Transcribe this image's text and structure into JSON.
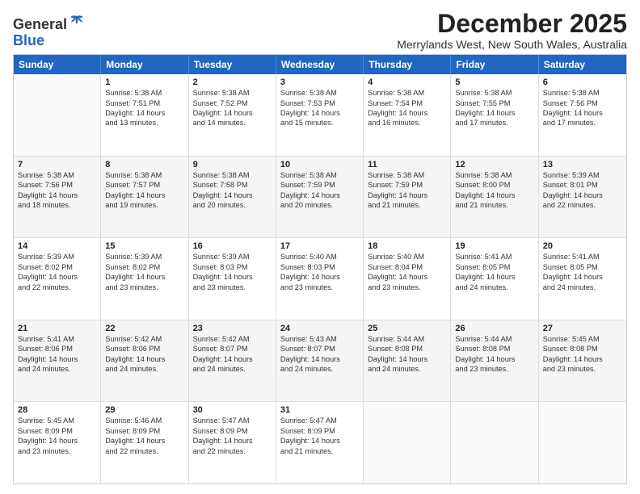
{
  "logo": {
    "general": "General",
    "blue": "Blue"
  },
  "title": "December 2025",
  "location": "Merrylands West, New South Wales, Australia",
  "days": [
    "Sunday",
    "Monday",
    "Tuesday",
    "Wednesday",
    "Thursday",
    "Friday",
    "Saturday"
  ],
  "weeks": [
    [
      {
        "day": "",
        "lines": []
      },
      {
        "day": "1",
        "lines": [
          "Sunrise: 5:38 AM",
          "Sunset: 7:51 PM",
          "Daylight: 14 hours",
          "and 13 minutes."
        ]
      },
      {
        "day": "2",
        "lines": [
          "Sunrise: 5:38 AM",
          "Sunset: 7:52 PM",
          "Daylight: 14 hours",
          "and 14 minutes."
        ]
      },
      {
        "day": "3",
        "lines": [
          "Sunrise: 5:38 AM",
          "Sunset: 7:53 PM",
          "Daylight: 14 hours",
          "and 15 minutes."
        ]
      },
      {
        "day": "4",
        "lines": [
          "Sunrise: 5:38 AM",
          "Sunset: 7:54 PM",
          "Daylight: 14 hours",
          "and 16 minutes."
        ]
      },
      {
        "day": "5",
        "lines": [
          "Sunrise: 5:38 AM",
          "Sunset: 7:55 PM",
          "Daylight: 14 hours",
          "and 17 minutes."
        ]
      },
      {
        "day": "6",
        "lines": [
          "Sunrise: 5:38 AM",
          "Sunset: 7:56 PM",
          "Daylight: 14 hours",
          "and 17 minutes."
        ]
      }
    ],
    [
      {
        "day": "7",
        "lines": [
          "Sunrise: 5:38 AM",
          "Sunset: 7:56 PM",
          "Daylight: 14 hours",
          "and 18 minutes."
        ]
      },
      {
        "day": "8",
        "lines": [
          "Sunrise: 5:38 AM",
          "Sunset: 7:57 PM",
          "Daylight: 14 hours",
          "and 19 minutes."
        ]
      },
      {
        "day": "9",
        "lines": [
          "Sunrise: 5:38 AM",
          "Sunset: 7:58 PM",
          "Daylight: 14 hours",
          "and 20 minutes."
        ]
      },
      {
        "day": "10",
        "lines": [
          "Sunrise: 5:38 AM",
          "Sunset: 7:59 PM",
          "Daylight: 14 hours",
          "and 20 minutes."
        ]
      },
      {
        "day": "11",
        "lines": [
          "Sunrise: 5:38 AM",
          "Sunset: 7:59 PM",
          "Daylight: 14 hours",
          "and 21 minutes."
        ]
      },
      {
        "day": "12",
        "lines": [
          "Sunrise: 5:38 AM",
          "Sunset: 8:00 PM",
          "Daylight: 14 hours",
          "and 21 minutes."
        ]
      },
      {
        "day": "13",
        "lines": [
          "Sunrise: 5:39 AM",
          "Sunset: 8:01 PM",
          "Daylight: 14 hours",
          "and 22 minutes."
        ]
      }
    ],
    [
      {
        "day": "14",
        "lines": [
          "Sunrise: 5:39 AM",
          "Sunset: 8:02 PM",
          "Daylight: 14 hours",
          "and 22 minutes."
        ]
      },
      {
        "day": "15",
        "lines": [
          "Sunrise: 5:39 AM",
          "Sunset: 8:02 PM",
          "Daylight: 14 hours",
          "and 23 minutes."
        ]
      },
      {
        "day": "16",
        "lines": [
          "Sunrise: 5:39 AM",
          "Sunset: 8:03 PM",
          "Daylight: 14 hours",
          "and 23 minutes."
        ]
      },
      {
        "day": "17",
        "lines": [
          "Sunrise: 5:40 AM",
          "Sunset: 8:03 PM",
          "Daylight: 14 hours",
          "and 23 minutes."
        ]
      },
      {
        "day": "18",
        "lines": [
          "Sunrise: 5:40 AM",
          "Sunset: 8:04 PM",
          "Daylight: 14 hours",
          "and 23 minutes."
        ]
      },
      {
        "day": "19",
        "lines": [
          "Sunrise: 5:41 AM",
          "Sunset: 8:05 PM",
          "Daylight: 14 hours",
          "and 24 minutes."
        ]
      },
      {
        "day": "20",
        "lines": [
          "Sunrise: 5:41 AM",
          "Sunset: 8:05 PM",
          "Daylight: 14 hours",
          "and 24 minutes."
        ]
      }
    ],
    [
      {
        "day": "21",
        "lines": [
          "Sunrise: 5:41 AM",
          "Sunset: 8:06 PM",
          "Daylight: 14 hours",
          "and 24 minutes."
        ]
      },
      {
        "day": "22",
        "lines": [
          "Sunrise: 5:42 AM",
          "Sunset: 8:06 PM",
          "Daylight: 14 hours",
          "and 24 minutes."
        ]
      },
      {
        "day": "23",
        "lines": [
          "Sunrise: 5:42 AM",
          "Sunset: 8:07 PM",
          "Daylight: 14 hours",
          "and 24 minutes."
        ]
      },
      {
        "day": "24",
        "lines": [
          "Sunrise: 5:43 AM",
          "Sunset: 8:07 PM",
          "Daylight: 14 hours",
          "and 24 minutes."
        ]
      },
      {
        "day": "25",
        "lines": [
          "Sunrise: 5:44 AM",
          "Sunset: 8:08 PM",
          "Daylight: 14 hours",
          "and 24 minutes."
        ]
      },
      {
        "day": "26",
        "lines": [
          "Sunrise: 5:44 AM",
          "Sunset: 8:08 PM",
          "Daylight: 14 hours",
          "and 23 minutes."
        ]
      },
      {
        "day": "27",
        "lines": [
          "Sunrise: 5:45 AM",
          "Sunset: 8:08 PM",
          "Daylight: 14 hours",
          "and 23 minutes."
        ]
      }
    ],
    [
      {
        "day": "28",
        "lines": [
          "Sunrise: 5:45 AM",
          "Sunset: 8:09 PM",
          "Daylight: 14 hours",
          "and 23 minutes."
        ]
      },
      {
        "day": "29",
        "lines": [
          "Sunrise: 5:46 AM",
          "Sunset: 8:09 PM",
          "Daylight: 14 hours",
          "and 22 minutes."
        ]
      },
      {
        "day": "30",
        "lines": [
          "Sunrise: 5:47 AM",
          "Sunset: 8:09 PM",
          "Daylight: 14 hours",
          "and 22 minutes."
        ]
      },
      {
        "day": "31",
        "lines": [
          "Sunrise: 5:47 AM",
          "Sunset: 8:09 PM",
          "Daylight: 14 hours",
          "and 21 minutes."
        ]
      },
      {
        "day": "",
        "lines": []
      },
      {
        "day": "",
        "lines": []
      },
      {
        "day": "",
        "lines": []
      }
    ]
  ]
}
